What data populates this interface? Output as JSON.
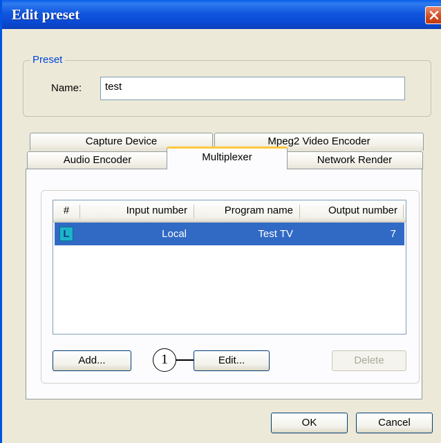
{
  "window": {
    "title": "Edit preset"
  },
  "preset_group": {
    "legend": "Preset",
    "name_label": "Name:",
    "name_value": "test"
  },
  "tabs": {
    "row1": [
      "Capture Device",
      "Mpeg2 Video Encoder"
    ],
    "row2": [
      "Audio Encoder",
      "Multiplexer",
      "Network Render"
    ],
    "active": "Multiplexer"
  },
  "table": {
    "columns": [
      "#",
      "Input number",
      "Program name",
      "Output number"
    ],
    "rows": [
      {
        "icon": "L",
        "input_number": "Local",
        "program_name": "Test TV",
        "output_number": "7",
        "selected": true
      }
    ]
  },
  "buttons": {
    "add": "Add...",
    "edit": "Edit...",
    "delete": "Delete",
    "ok": "OK",
    "cancel": "Cancel"
  },
  "callout": {
    "number": "1"
  },
  "colors": {
    "titlebar": "#0a48d2",
    "selection": "#316ac5",
    "tab_highlight": "#ffc83c",
    "group_legend": "#0046d5"
  }
}
